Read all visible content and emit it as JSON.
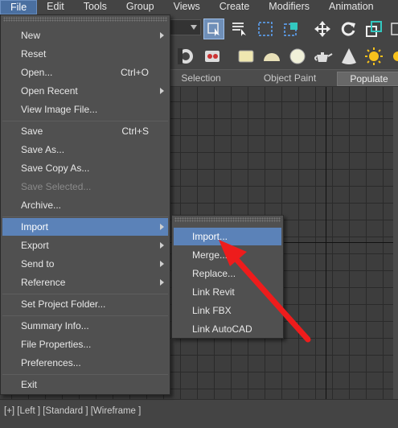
{
  "menubar": {
    "items": [
      "File",
      "Edit",
      "Tools",
      "Group",
      "Views",
      "Create",
      "Modifiers",
      "Animation"
    ]
  },
  "ribbon": {
    "tabs": [
      "Selection",
      "Object Paint",
      "Populate"
    ],
    "selected": "Populate"
  },
  "file_menu": {
    "items": [
      {
        "label": "New",
        "has_submenu": true
      },
      {
        "label": "Reset"
      },
      {
        "label": "Open...",
        "shortcut": "Ctrl+O"
      },
      {
        "label": "Open Recent",
        "has_submenu": true
      },
      {
        "label": "View Image File..."
      },
      {
        "label": "Save",
        "shortcut": "Ctrl+S"
      },
      {
        "label": "Save As..."
      },
      {
        "label": "Save Copy As..."
      },
      {
        "label": "Save Selected...",
        "disabled": true
      },
      {
        "label": "Archive..."
      },
      {
        "label": "Import",
        "has_submenu": true,
        "highlighted": true
      },
      {
        "label": "Export",
        "has_submenu": true
      },
      {
        "label": "Send to",
        "has_submenu": true
      },
      {
        "label": "Reference",
        "has_submenu": true
      },
      {
        "label": "Set Project Folder..."
      },
      {
        "label": "Summary Info..."
      },
      {
        "label": "File Properties..."
      },
      {
        "label": "Preferences..."
      },
      {
        "label": "Exit"
      }
    ]
  },
  "import_submenu": {
    "items": [
      {
        "label": "Import...",
        "highlighted": true
      },
      {
        "label": "Merge..."
      },
      {
        "label": "Replace..."
      },
      {
        "label": "Link Revit"
      },
      {
        "label": "Link FBX"
      },
      {
        "label": "Link AutoCAD"
      }
    ]
  },
  "viewport": {
    "label": "[+] [Left ] [Standard ] [Wireframe ]"
  },
  "colors": {
    "highlight": "#5b82b8",
    "menu_bg": "#505050",
    "annotation_arrow": "#ee1c1c"
  },
  "icons": [
    "select-object-icon",
    "select-by-name-icon",
    "rectangular-selection-icon",
    "window-crossing-icon",
    "move-icon",
    "rotate-icon",
    "scale-icon",
    "teapot-icon",
    "sphere-icon",
    "cone-icon",
    "sun-light-icon"
  ]
}
